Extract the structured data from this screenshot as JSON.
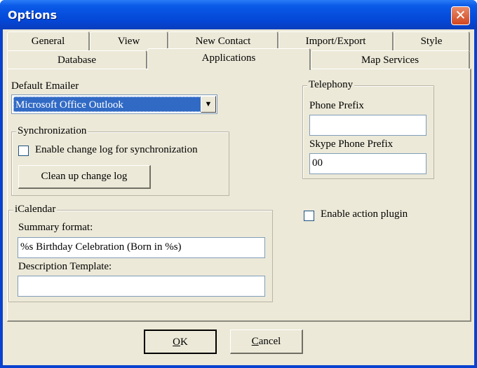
{
  "window": {
    "title": "Options"
  },
  "tabs": {
    "row1": [
      "General",
      "View",
      "New Contact",
      "Import/Export",
      "Style"
    ],
    "row2": [
      "Database",
      "Applications",
      "Map Services"
    ],
    "selected": "Applications"
  },
  "emailer": {
    "label": "Default Emailer",
    "value": "Microsoft Office Outlook"
  },
  "sync": {
    "title": "Synchronization",
    "checkbox_label": "Enable change log for synchronization",
    "checked": false,
    "cleanup_label": "Clean up change log"
  },
  "icalendar": {
    "title": "iCalendar",
    "summary_label": "Summary format:",
    "summary_value": "%s Birthday Celebration (Born in %s)",
    "description_label": "Description Template:",
    "description_value": ""
  },
  "telephony": {
    "title": "Telephony",
    "phone_prefix_label": "Phone Prefix",
    "phone_prefix_value": "",
    "skype_label": "Skype Phone Prefix",
    "skype_value": "00"
  },
  "plugin": {
    "label": "Enable action plugin",
    "checked": false
  },
  "buttons": {
    "ok_accel": "O",
    "ok_rest": "K",
    "cancel_accel": "C",
    "cancel_rest": "ancel"
  }
}
